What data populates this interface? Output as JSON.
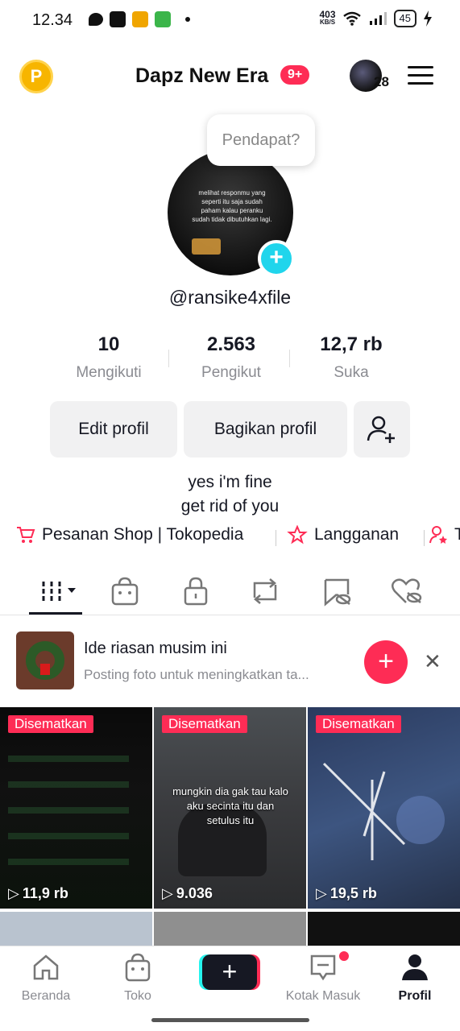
{
  "status_bar": {
    "time": "12.34",
    "net_speed_value": "403",
    "net_speed_unit": "KB/S",
    "battery": "45"
  },
  "header": {
    "title": "Dapz New Era",
    "notification_badge": "9+",
    "points_icon_letter": "P",
    "avatar_count": "28"
  },
  "profile": {
    "tooltip": "Pendapat?",
    "photo_text": "melihat responmu yang seperti itu saja sudah paham kalau peranku sudah tidak dibutuhkan lagi.",
    "username": "@ransike4xfile",
    "stats": [
      {
        "value": "10",
        "label": "Mengikuti"
      },
      {
        "value": "2.563",
        "label": "Pengikut"
      },
      {
        "value": "12,7 rb",
        "label": "Suka"
      }
    ],
    "edit_button": "Edit profil",
    "share_button": "Bagikan profil",
    "bio_line1": "yes i'm fine",
    "bio_line2": "get rid of you"
  },
  "links": [
    {
      "label": "Pesanan Shop | Tokopedia",
      "icon": "cart-icon"
    },
    {
      "label": "Langganan",
      "icon": "star-hands-icon"
    },
    {
      "label": "T",
      "icon": "user-star-icon"
    }
  ],
  "tabs": [
    "videos-grid",
    "shop-bag",
    "private-lock",
    "reposts",
    "favorites",
    "liked"
  ],
  "suggestion": {
    "title": "Ide riasan musim ini",
    "subtitle": "Posting foto untuk meningkatkan ta..."
  },
  "videos": [
    {
      "pinned": "Disematkan",
      "views": "11,9 rb",
      "caption": ""
    },
    {
      "pinned": "Disematkan",
      "views": "9.036",
      "caption": "mungkin dia gak tau kalo aku secinta itu dan setulus itu"
    },
    {
      "pinned": "Disematkan",
      "views": "19,5 rb",
      "caption": ""
    }
  ],
  "bottom_nav": [
    {
      "label": "Beranda",
      "icon": "home-icon"
    },
    {
      "label": "Toko",
      "icon": "shop-icon"
    },
    {
      "label": "Kotak Masuk",
      "icon": "inbox-icon"
    },
    {
      "label": "Profil",
      "icon": "profile-icon"
    }
  ],
  "colors": {
    "accent": "#fe2c55",
    "cyan": "#20d5ec",
    "text": "#161823",
    "muted": "#8a8b91"
  }
}
